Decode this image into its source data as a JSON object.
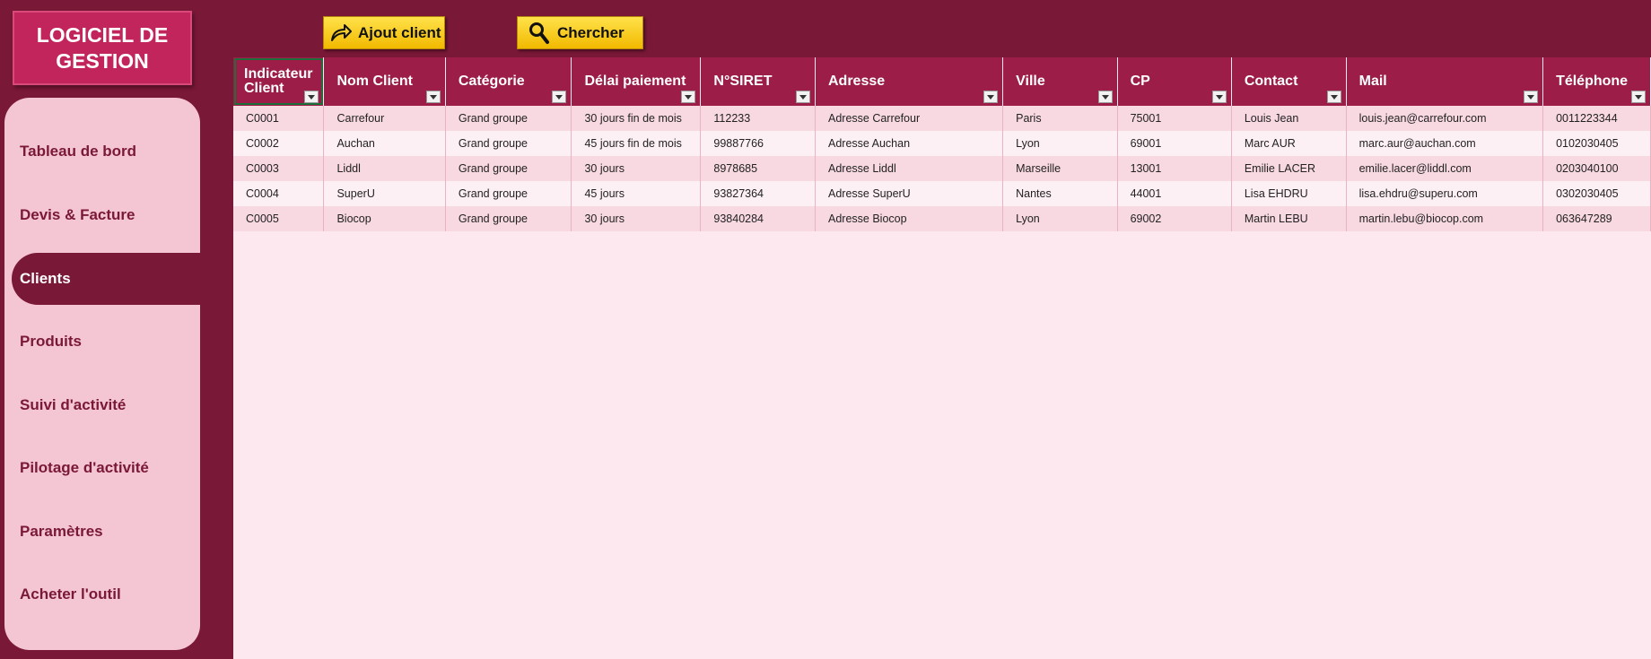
{
  "app": {
    "logo_text": "LOGICIEL DE GESTION"
  },
  "toolbar": {
    "add_client_label": "Ajout client",
    "search_label": "Chercher"
  },
  "sidebar": {
    "items": [
      {
        "label": "Tableau de bord",
        "active": false
      },
      {
        "label": "Devis & Facture",
        "active": false
      },
      {
        "label": "Clients",
        "active": true
      },
      {
        "label": "Produits",
        "active": false
      },
      {
        "label": "Suivi d'activité",
        "active": false
      },
      {
        "label": "Pilotage d'activité",
        "active": false
      },
      {
        "label": "Paramètres",
        "active": false
      },
      {
        "label": "Acheter l'outil",
        "active": false
      }
    ]
  },
  "table": {
    "headers": [
      "Indicateur Client",
      "Nom Client",
      "Catégorie",
      "Délai paiement",
      "N°SIRET",
      "Adresse",
      "Ville",
      "CP",
      "Contact",
      "Mail",
      "Téléphone"
    ],
    "rows": [
      [
        "C0001",
        "Carrefour",
        "Grand groupe",
        "30 jours fin de mois",
        "112233",
        "Adresse Carrefour",
        "Paris",
        "75001",
        "Louis Jean",
        "louis.jean@carrefour.com",
        "0011223344"
      ],
      [
        "C0002",
        "Auchan",
        "Grand groupe",
        "45 jours fin de mois",
        "99887766",
        "Adresse Auchan",
        "Lyon",
        "69001",
        "Marc AUR",
        "marc.aur@auchan.com",
        "0102030405"
      ],
      [
        "C0003",
        "Liddl",
        "Grand groupe",
        "30 jours",
        "8978685",
        "Adresse Liddl",
        "Marseille",
        "13001",
        "Emilie LACER",
        "emilie.lacer@liddl.com",
        "0203040100"
      ],
      [
        "C0004",
        "SuperU",
        "Grand groupe",
        "45 jours",
        "93827364",
        "Adresse SuperU",
        "Nantes",
        "44001",
        "Lisa EHDRU",
        "lisa.ehdru@superu.com",
        "0302030405"
      ],
      [
        "C0005",
        "Biocop",
        "Grand groupe",
        "30 jours",
        "93840284",
        "Adresse Biocop",
        "Lyon",
        "69002",
        "Martin LEBU",
        "martin.lebu@biocop.com",
        "063647289"
      ]
    ]
  },
  "colors": {
    "background": "#7a1838",
    "header": "#9b1d48",
    "sidebar_panel": "#f4c5d3",
    "button": "#ffd21f"
  },
  "icons": {
    "add_client": "share-arrow-icon",
    "search": "magnifier-icon",
    "filter": "dropdown-arrow-icon"
  }
}
